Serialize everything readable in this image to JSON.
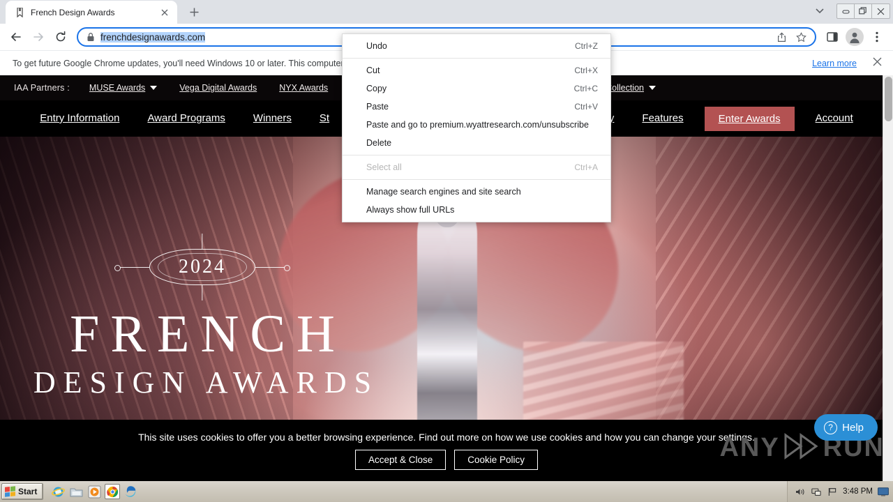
{
  "browser": {
    "tab": {
      "title": "French Design Awards",
      "favicon_icon": "bookmark-icon",
      "close_icon": "close-icon"
    },
    "new_tab_label": "+",
    "tab_list_icon": "chevron-down-icon",
    "window_controls": {
      "minimize": "–",
      "restore": "❐",
      "close": "✕"
    },
    "toolbar": {
      "back_icon": "back-arrow-icon",
      "forward_icon": "forward-arrow-icon",
      "reload_icon": "reload-icon",
      "lock_icon": "lock-icon",
      "url": "frenchdesignawards.com",
      "share_icon": "share-icon",
      "bookmark_icon": "star-icon",
      "side_panel_icon": "side-panel-icon",
      "profile_icon": "profile-avatar-icon",
      "menu_icon": "three-dot-menu-icon"
    },
    "infobar": {
      "message": "To get future Google Chrome updates, you'll need Windows 10 or later. This computer is using Windows 8.1.",
      "learn_more": "Learn more",
      "close_icon": "close-icon"
    }
  },
  "context_menu": {
    "groups": [
      [
        {
          "label": "Undo",
          "accel": "Ctrl+Z",
          "disabled": false
        }
      ],
      [
        {
          "label": "Cut",
          "accel": "Ctrl+X",
          "disabled": false
        },
        {
          "label": "Copy",
          "accel": "Ctrl+C",
          "disabled": false
        },
        {
          "label": "Paste",
          "accel": "Ctrl+V",
          "disabled": false
        },
        {
          "label": "Paste and go to premium.wyattresearch.com/unsubscribe",
          "accel": "",
          "disabled": false
        },
        {
          "label": "Delete",
          "accel": "",
          "disabled": false
        }
      ],
      [
        {
          "label": "Select all",
          "accel": "Ctrl+A",
          "disabled": true
        }
      ],
      [
        {
          "label": "Manage search engines and site search",
          "accel": "",
          "disabled": false
        },
        {
          "label": "Always show full URLs",
          "accel": "",
          "disabled": false
        }
      ]
    ]
  },
  "page": {
    "partner_bar": {
      "label": "IAA Partners :",
      "items": [
        {
          "label": "MUSE Awards",
          "has_caret": true
        },
        {
          "label": "Vega Digital Awards",
          "has_caret": false
        },
        {
          "label": "NYX Awards",
          "has_caret": false
        },
        {
          "label": "Arte Collection",
          "has_caret": true
        }
      ]
    },
    "nav": {
      "items": [
        {
          "label": "Entry Information",
          "cta": false
        },
        {
          "label": "Award Programs",
          "cta": false
        },
        {
          "label": "Winners",
          "cta": false
        },
        {
          "label": "St",
          "cta": false
        },
        {
          "label": "Jury",
          "cta": false
        },
        {
          "label": "Features",
          "cta": false
        },
        {
          "label": "Enter Awards",
          "cta": true
        },
        {
          "label": "Account",
          "cta": false
        }
      ],
      "cta_color": "#b35252"
    },
    "hero": {
      "year_badge": "2024",
      "title_line1": "FRENCH",
      "title_line2": "DESIGN AWARDS"
    },
    "cookie_banner": {
      "text": "This site uses cookies to offer you a better browsing experience. Find out more on how we use cookies and how you can change your settings.",
      "accept_label": "Accept & Close",
      "policy_label": "Cookie Policy"
    }
  },
  "overlay": {
    "watermark_any": "ANY",
    "watermark_run": "RUN",
    "help_label": "Help",
    "help_icon": "question-mark-icon",
    "help_color": "#2b8fd6"
  },
  "taskbar": {
    "start_label": "Start",
    "quicklaunch": [
      {
        "icon": "internet-explorer-icon",
        "active": false
      },
      {
        "icon": "folder-icon",
        "active": false
      },
      {
        "icon": "media-player-icon",
        "active": false
      },
      {
        "icon": "google-chrome-icon",
        "active": true
      },
      {
        "icon": "microsoft-edge-icon",
        "active": false
      }
    ],
    "tray": {
      "volume_icon": "volume-icon",
      "network_icon": "network-icon",
      "flag_icon": "flag-icon",
      "clock": "3:48 PM",
      "show_desktop_icon": "show-desktop-icon"
    }
  }
}
